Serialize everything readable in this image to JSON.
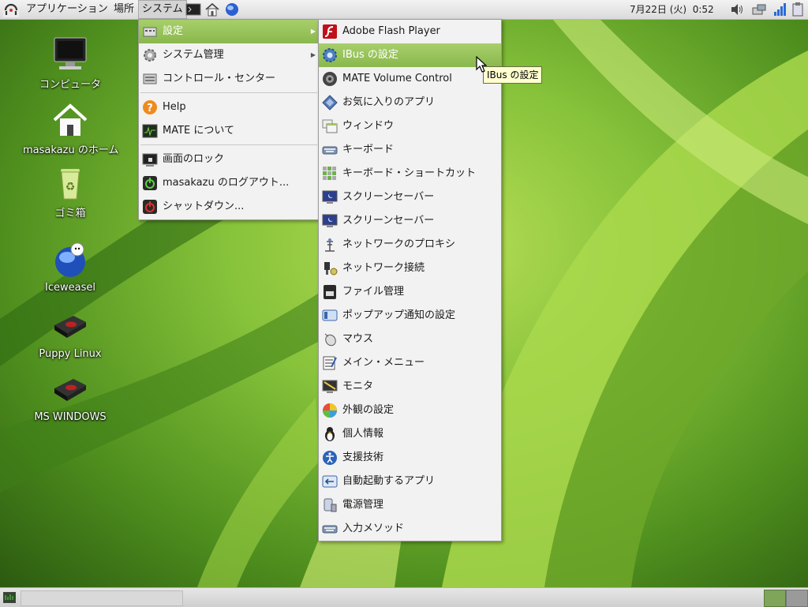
{
  "top_panel": {
    "menus": [
      "アプリケーション",
      "場所",
      "システム"
    ],
    "clock": "7月22日 (火)  0:52"
  },
  "desktop": {
    "icons": [
      {
        "label": "コンピュータ",
        "icon": "computer-icon"
      },
      {
        "label": "masakazu のホーム",
        "icon": "home-folder-icon"
      },
      {
        "label": "ゴミ箱",
        "icon": "trash-icon"
      },
      {
        "label": "Iceweasel",
        "icon": "iceweasel-icon"
      },
      {
        "label": "Puppy Linux",
        "icon": "drive-icon"
      },
      {
        "label": "MS WINDOWS",
        "icon": "drive-icon"
      }
    ]
  },
  "system_menu": {
    "items": [
      {
        "label": "設定",
        "icon": "preferences-icon",
        "submenu": true,
        "highlighted": true
      },
      {
        "label": "システム管理",
        "icon": "gear-icon",
        "submenu": true
      },
      {
        "label": "コントロール・センター",
        "icon": "control-center-icon"
      },
      {
        "label": "Help",
        "icon": "help-icon"
      },
      {
        "label": "MATE について",
        "icon": "about-icon"
      },
      {
        "label": "画面のロック",
        "icon": "lock-screen-icon"
      },
      {
        "label": "masakazu のログアウト...",
        "icon": "logout-icon"
      },
      {
        "label": "シャットダウン...",
        "icon": "shutdown-icon"
      }
    ]
  },
  "settings_submenu": {
    "items": [
      {
        "label": "Adobe Flash Player",
        "icon": "flash-icon"
      },
      {
        "label": "IBus の設定",
        "icon": "ibus-icon",
        "highlighted": true
      },
      {
        "label": "MATE Volume Control",
        "icon": "speaker-icon"
      },
      {
        "label": "お気に入りのアプリ",
        "icon": "favorite-apps-icon"
      },
      {
        "label": "ウィンドウ",
        "icon": "window-icon"
      },
      {
        "label": "キーボード",
        "icon": "keyboard-icon"
      },
      {
        "label": "キーボード・ショートカット",
        "icon": "shortcuts-icon"
      },
      {
        "label": "スクリーンセーバー",
        "icon": "screensaver-icon"
      },
      {
        "label": "スクリーンセーバー",
        "icon": "screensaver-icon"
      },
      {
        "label": "ネットワークのプロキシ",
        "icon": "proxy-icon"
      },
      {
        "label": "ネットワーク接続",
        "icon": "network-icon"
      },
      {
        "label": "ファイル管理",
        "icon": "file-manager-icon"
      },
      {
        "label": "ポップアップ通知の設定",
        "icon": "notification-icon"
      },
      {
        "label": "マウス",
        "icon": "mouse-icon"
      },
      {
        "label": "メイン・メニュー",
        "icon": "main-menu-icon"
      },
      {
        "label": "モニタ",
        "icon": "monitor-icon"
      },
      {
        "label": "外観の設定",
        "icon": "appearance-icon"
      },
      {
        "label": "個人情報",
        "icon": "penguin-icon"
      },
      {
        "label": "支援技術",
        "icon": "accessibility-icon"
      },
      {
        "label": "自動起動するアプリ",
        "icon": "autostart-icon"
      },
      {
        "label": "電源管理",
        "icon": "power-icon"
      },
      {
        "label": "入力メソッド",
        "icon": "input-method-icon"
      }
    ]
  },
  "tooltip": "IBus の設定",
  "colors": {
    "highlight": "#8ab84d",
    "wallpaper": "#86c23a"
  }
}
